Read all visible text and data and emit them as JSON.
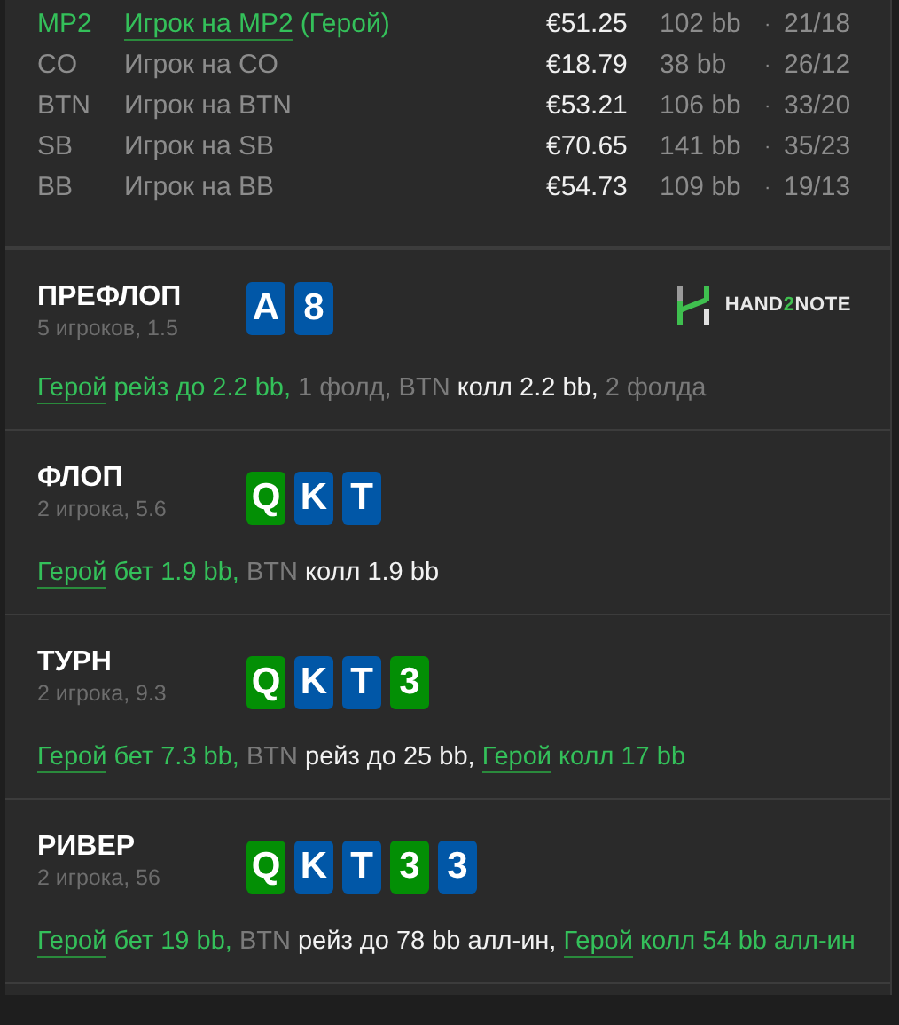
{
  "players": [
    {
      "position": "MP2",
      "name": "Игрок на MP2",
      "hero_tag": "(Герой)",
      "hero": true,
      "stack": "€51.25",
      "bb": "102 bb",
      "dot": "·",
      "ratio": "21/18"
    },
    {
      "position": "CO",
      "name": "Игрок на CO",
      "hero": false,
      "stack": "€18.79",
      "bb": "38 bb",
      "dot": "·",
      "ratio": "26/12"
    },
    {
      "position": "BTN",
      "name": "Игрок на BTN",
      "hero": false,
      "stack": "€53.21",
      "bb": "106 bb",
      "dot": "·",
      "ratio": "33/20"
    },
    {
      "position": "SB",
      "name": "Игрок на SB",
      "hero": false,
      "stack": "€70.65",
      "bb": "141 bb",
      "dot": "·",
      "ratio": "35/23"
    },
    {
      "position": "BB",
      "name": "Игрок на BB",
      "hero": false,
      "stack": "€54.73",
      "bb": "109 bb",
      "dot": "·",
      "ratio": "19/13"
    }
  ],
  "streets": [
    {
      "title": "ПРЕФЛОП",
      "info": "5 игроков, 1.5",
      "logo": [
        {
          "text": "HAND",
          "accent": false
        },
        {
          "text": "2",
          "accent": true
        },
        {
          "text": "NOTE",
          "accent": false
        }
      ],
      "cards": [
        {
          "rank": "A",
          "color": "#0157a7"
        },
        {
          "rank": "8",
          "color": "#0157a7"
        }
      ],
      "actions": [
        {
          "kind": "hero",
          "text": "Герой"
        },
        {
          "kind": "hero_text",
          "text": " рейз до 2.2 bb, "
        },
        {
          "kind": "muted",
          "text": "1 фолд, BTN "
        },
        {
          "kind": "bright",
          "text": "колл 2.2 bb, "
        },
        {
          "kind": "muted",
          "text": "2 фолда"
        }
      ]
    },
    {
      "title": "ФЛОП",
      "info": "2 игрока, 5.6",
      "cards": [
        {
          "rank": "Q",
          "color": "#038f05"
        },
        {
          "rank": "K",
          "color": "#0157a7"
        },
        {
          "rank": "T",
          "color": "#0157a7"
        }
      ],
      "actions": [
        {
          "kind": "hero",
          "text": "Герой"
        },
        {
          "kind": "hero_text",
          "text": " бет 1.9 bb, "
        },
        {
          "kind": "muted",
          "text": "BTN "
        },
        {
          "kind": "bright",
          "text": "колл 1.9 bb"
        }
      ]
    },
    {
      "title": "ТУРН",
      "info": "2 игрока, 9.3",
      "cards": [
        {
          "rank": "Q",
          "color": "#038f05"
        },
        {
          "rank": "K",
          "color": "#0157a7"
        },
        {
          "rank": "T",
          "color": "#0157a7"
        },
        {
          "rank": "3",
          "color": "#038f05"
        }
      ],
      "actions": [
        {
          "kind": "hero",
          "text": "Герой"
        },
        {
          "kind": "hero_text",
          "text": " бет 7.3 bb, "
        },
        {
          "kind": "muted",
          "text": "BTN "
        },
        {
          "kind": "bright",
          "text": "рейз до 25 bb, "
        },
        {
          "kind": "hero",
          "text": "Герой"
        },
        {
          "kind": "hero_text",
          "text": " колл 17 bb"
        }
      ]
    },
    {
      "title": "РИВЕР",
      "info": "2 игрока, 56",
      "cards": [
        {
          "rank": "Q",
          "color": "#038f05"
        },
        {
          "rank": "K",
          "color": "#0157a7"
        },
        {
          "rank": "T",
          "color": "#0157a7"
        },
        {
          "rank": "3",
          "color": "#038f05"
        },
        {
          "rank": "3",
          "color": "#0157a7"
        }
      ],
      "actions": [
        {
          "kind": "hero",
          "text": "Герой"
        },
        {
          "kind": "hero_text",
          "text": " бет 19 bb, "
        },
        {
          "kind": "muted",
          "text": "BTN "
        },
        {
          "kind": "bright",
          "text": "рейз до 78 bb алл-ин, "
        },
        {
          "kind": "hero",
          "text": "Герой"
        },
        {
          "kind": "hero_text",
          "text": " колл 54 bb алл-ин"
        }
      ]
    }
  ]
}
